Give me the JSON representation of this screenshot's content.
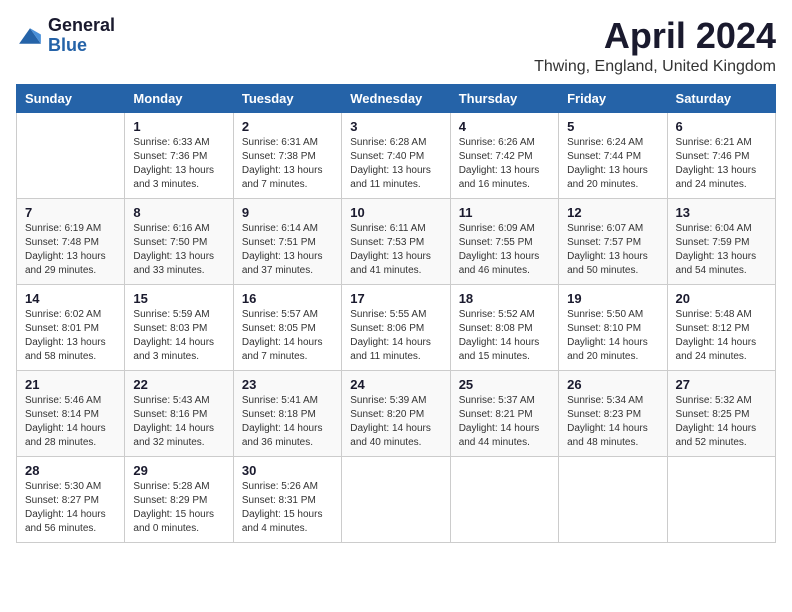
{
  "logo": {
    "general": "General",
    "blue": "Blue"
  },
  "title": "April 2024",
  "location": "Thwing, England, United Kingdom",
  "days_of_week": [
    "Sunday",
    "Monday",
    "Tuesday",
    "Wednesday",
    "Thursday",
    "Friday",
    "Saturday"
  ],
  "weeks": [
    [
      {
        "day": "",
        "sunrise": "",
        "sunset": "",
        "daylight": ""
      },
      {
        "day": "1",
        "sunrise": "Sunrise: 6:33 AM",
        "sunset": "Sunset: 7:36 PM",
        "daylight": "Daylight: 13 hours and 3 minutes."
      },
      {
        "day": "2",
        "sunrise": "Sunrise: 6:31 AM",
        "sunset": "Sunset: 7:38 PM",
        "daylight": "Daylight: 13 hours and 7 minutes."
      },
      {
        "day": "3",
        "sunrise": "Sunrise: 6:28 AM",
        "sunset": "Sunset: 7:40 PM",
        "daylight": "Daylight: 13 hours and 11 minutes."
      },
      {
        "day": "4",
        "sunrise": "Sunrise: 6:26 AM",
        "sunset": "Sunset: 7:42 PM",
        "daylight": "Daylight: 13 hours and 16 minutes."
      },
      {
        "day": "5",
        "sunrise": "Sunrise: 6:24 AM",
        "sunset": "Sunset: 7:44 PM",
        "daylight": "Daylight: 13 hours and 20 minutes."
      },
      {
        "day": "6",
        "sunrise": "Sunrise: 6:21 AM",
        "sunset": "Sunset: 7:46 PM",
        "daylight": "Daylight: 13 hours and 24 minutes."
      }
    ],
    [
      {
        "day": "7",
        "sunrise": "Sunrise: 6:19 AM",
        "sunset": "Sunset: 7:48 PM",
        "daylight": "Daylight: 13 hours and 29 minutes."
      },
      {
        "day": "8",
        "sunrise": "Sunrise: 6:16 AM",
        "sunset": "Sunset: 7:50 PM",
        "daylight": "Daylight: 13 hours and 33 minutes."
      },
      {
        "day": "9",
        "sunrise": "Sunrise: 6:14 AM",
        "sunset": "Sunset: 7:51 PM",
        "daylight": "Daylight: 13 hours and 37 minutes."
      },
      {
        "day": "10",
        "sunrise": "Sunrise: 6:11 AM",
        "sunset": "Sunset: 7:53 PM",
        "daylight": "Daylight: 13 hours and 41 minutes."
      },
      {
        "day": "11",
        "sunrise": "Sunrise: 6:09 AM",
        "sunset": "Sunset: 7:55 PM",
        "daylight": "Daylight: 13 hours and 46 minutes."
      },
      {
        "day": "12",
        "sunrise": "Sunrise: 6:07 AM",
        "sunset": "Sunset: 7:57 PM",
        "daylight": "Daylight: 13 hours and 50 minutes."
      },
      {
        "day": "13",
        "sunrise": "Sunrise: 6:04 AM",
        "sunset": "Sunset: 7:59 PM",
        "daylight": "Daylight: 13 hours and 54 minutes."
      }
    ],
    [
      {
        "day": "14",
        "sunrise": "Sunrise: 6:02 AM",
        "sunset": "Sunset: 8:01 PM",
        "daylight": "Daylight: 13 hours and 58 minutes."
      },
      {
        "day": "15",
        "sunrise": "Sunrise: 5:59 AM",
        "sunset": "Sunset: 8:03 PM",
        "daylight": "Daylight: 14 hours and 3 minutes."
      },
      {
        "day": "16",
        "sunrise": "Sunrise: 5:57 AM",
        "sunset": "Sunset: 8:05 PM",
        "daylight": "Daylight: 14 hours and 7 minutes."
      },
      {
        "day": "17",
        "sunrise": "Sunrise: 5:55 AM",
        "sunset": "Sunset: 8:06 PM",
        "daylight": "Daylight: 14 hours and 11 minutes."
      },
      {
        "day": "18",
        "sunrise": "Sunrise: 5:52 AM",
        "sunset": "Sunset: 8:08 PM",
        "daylight": "Daylight: 14 hours and 15 minutes."
      },
      {
        "day": "19",
        "sunrise": "Sunrise: 5:50 AM",
        "sunset": "Sunset: 8:10 PM",
        "daylight": "Daylight: 14 hours and 20 minutes."
      },
      {
        "day": "20",
        "sunrise": "Sunrise: 5:48 AM",
        "sunset": "Sunset: 8:12 PM",
        "daylight": "Daylight: 14 hours and 24 minutes."
      }
    ],
    [
      {
        "day": "21",
        "sunrise": "Sunrise: 5:46 AM",
        "sunset": "Sunset: 8:14 PM",
        "daylight": "Daylight: 14 hours and 28 minutes."
      },
      {
        "day": "22",
        "sunrise": "Sunrise: 5:43 AM",
        "sunset": "Sunset: 8:16 PM",
        "daylight": "Daylight: 14 hours and 32 minutes."
      },
      {
        "day": "23",
        "sunrise": "Sunrise: 5:41 AM",
        "sunset": "Sunset: 8:18 PM",
        "daylight": "Daylight: 14 hours and 36 minutes."
      },
      {
        "day": "24",
        "sunrise": "Sunrise: 5:39 AM",
        "sunset": "Sunset: 8:20 PM",
        "daylight": "Daylight: 14 hours and 40 minutes."
      },
      {
        "day": "25",
        "sunrise": "Sunrise: 5:37 AM",
        "sunset": "Sunset: 8:21 PM",
        "daylight": "Daylight: 14 hours and 44 minutes."
      },
      {
        "day": "26",
        "sunrise": "Sunrise: 5:34 AM",
        "sunset": "Sunset: 8:23 PM",
        "daylight": "Daylight: 14 hours and 48 minutes."
      },
      {
        "day": "27",
        "sunrise": "Sunrise: 5:32 AM",
        "sunset": "Sunset: 8:25 PM",
        "daylight": "Daylight: 14 hours and 52 minutes."
      }
    ],
    [
      {
        "day": "28",
        "sunrise": "Sunrise: 5:30 AM",
        "sunset": "Sunset: 8:27 PM",
        "daylight": "Daylight: 14 hours and 56 minutes."
      },
      {
        "day": "29",
        "sunrise": "Sunrise: 5:28 AM",
        "sunset": "Sunset: 8:29 PM",
        "daylight": "Daylight: 15 hours and 0 minutes."
      },
      {
        "day": "30",
        "sunrise": "Sunrise: 5:26 AM",
        "sunset": "Sunset: 8:31 PM",
        "daylight": "Daylight: 15 hours and 4 minutes."
      },
      {
        "day": "",
        "sunrise": "",
        "sunset": "",
        "daylight": ""
      },
      {
        "day": "",
        "sunrise": "",
        "sunset": "",
        "daylight": ""
      },
      {
        "day": "",
        "sunrise": "",
        "sunset": "",
        "daylight": ""
      },
      {
        "day": "",
        "sunrise": "",
        "sunset": "",
        "daylight": ""
      }
    ]
  ]
}
